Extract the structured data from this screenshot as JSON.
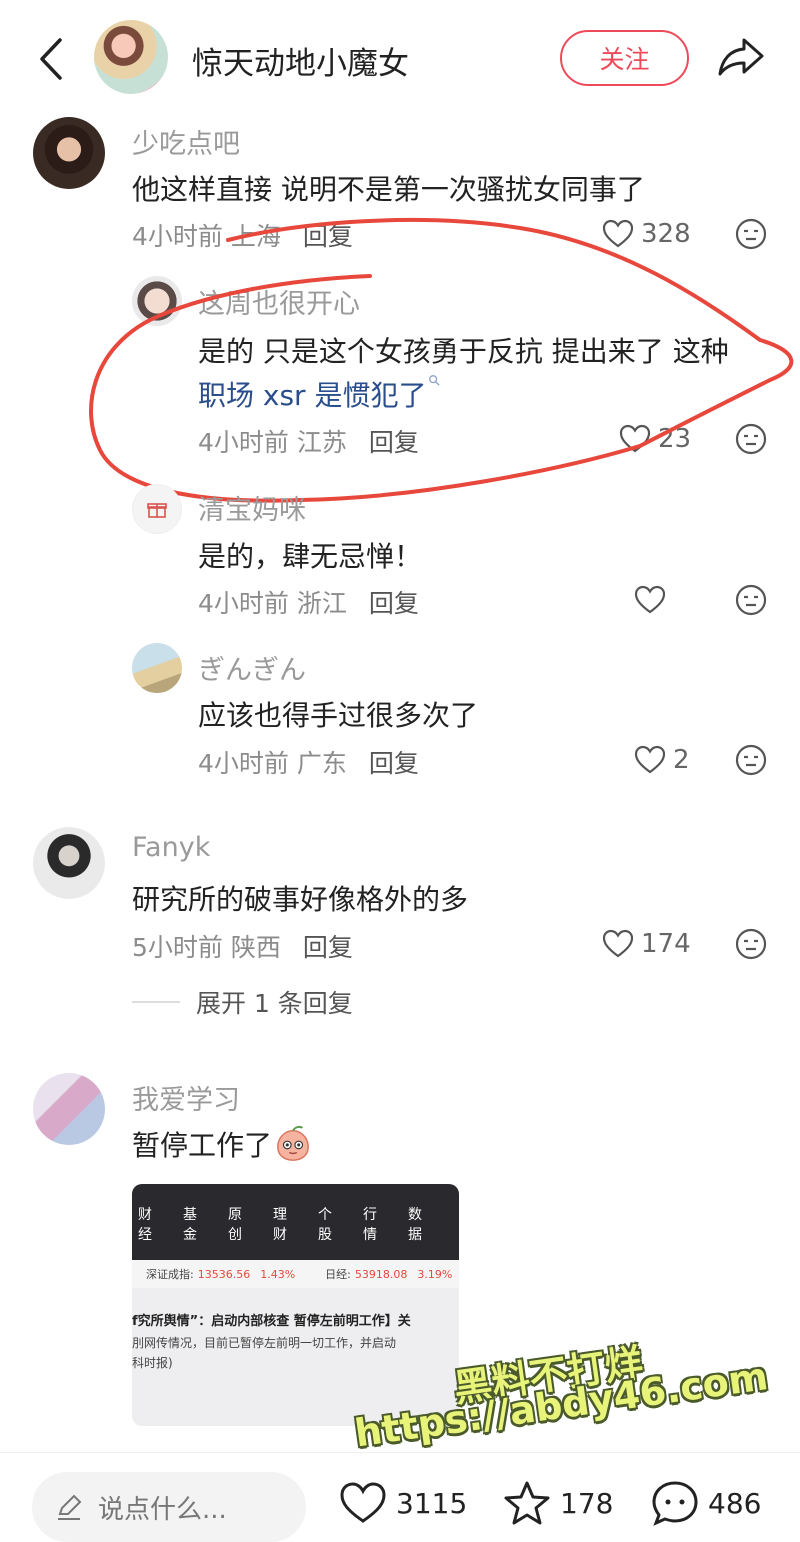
{
  "header": {
    "back_icon": "chevron-left-icon",
    "author_name": "惊天动地小魔女",
    "follow_label": "关注",
    "share_icon": "share-arrow-icon",
    "accent_color": "#ef4a5a"
  },
  "comments": [
    {
      "user": "少吃点吧",
      "text": "他这样直接 说明不是第一次骚扰女同事了",
      "time": "4小时前",
      "location": "上海",
      "reply_label": "回复",
      "likes": "328",
      "replies": [
        {
          "user": "这周也很开心",
          "text_line1": "是的 只是这个女孩勇于反抗 提出来了 这种",
          "text_link": "职场 xsr 是惯犯了",
          "time": "4小时前",
          "location": "江苏",
          "reply_label": "回复",
          "likes": "23"
        },
        {
          "user": "清宝妈咪",
          "text": "是的，肆无忌惮！",
          "time": "4小时前",
          "location": "浙江",
          "reply_label": "回复",
          "likes": ""
        },
        {
          "user": "ぎんぎん",
          "text": "应该也得手过很多次了",
          "time": "4小时前",
          "location": "广东",
          "reply_label": "回复",
          "likes": "2"
        }
      ]
    },
    {
      "user": "Fanyk",
      "text": "研究所的破事好像格外的多",
      "time": "5小时前",
      "location": "陕西",
      "reply_label": "回复",
      "likes": "174",
      "expand_label": "展开 1 条回复"
    },
    {
      "user": "我爱学习",
      "text": "暂停工作了",
      "emoji_icon": "shy-peach-emoji-icon"
    }
  ],
  "news_image": {
    "tabs": [
      "财经",
      "基金",
      "原创",
      "理财",
      "个股",
      "行情",
      "数据"
    ],
    "ticker1_label": "深证成指:",
    "ticker1_value": "13536.56",
    "ticker1_change": "1.43%",
    "ticker2_label": "日经:",
    "ticker2_value": "53918.08",
    "ticker2_change": "3.19%",
    "headline": "f究所舆情”：启动内部核查 暂停左前明工作】关",
    "body_line1": "刖网传情况，目前已暂停左前明一切工作，并启动",
    "body_line2": "科时报)"
  },
  "watermark": {
    "line1": "黑料不打烊",
    "line2": "https://abdy46.com"
  },
  "bottom_bar": {
    "input_placeholder": "说点什么...",
    "likes": "3115",
    "favorites": "178",
    "comments": "486"
  }
}
